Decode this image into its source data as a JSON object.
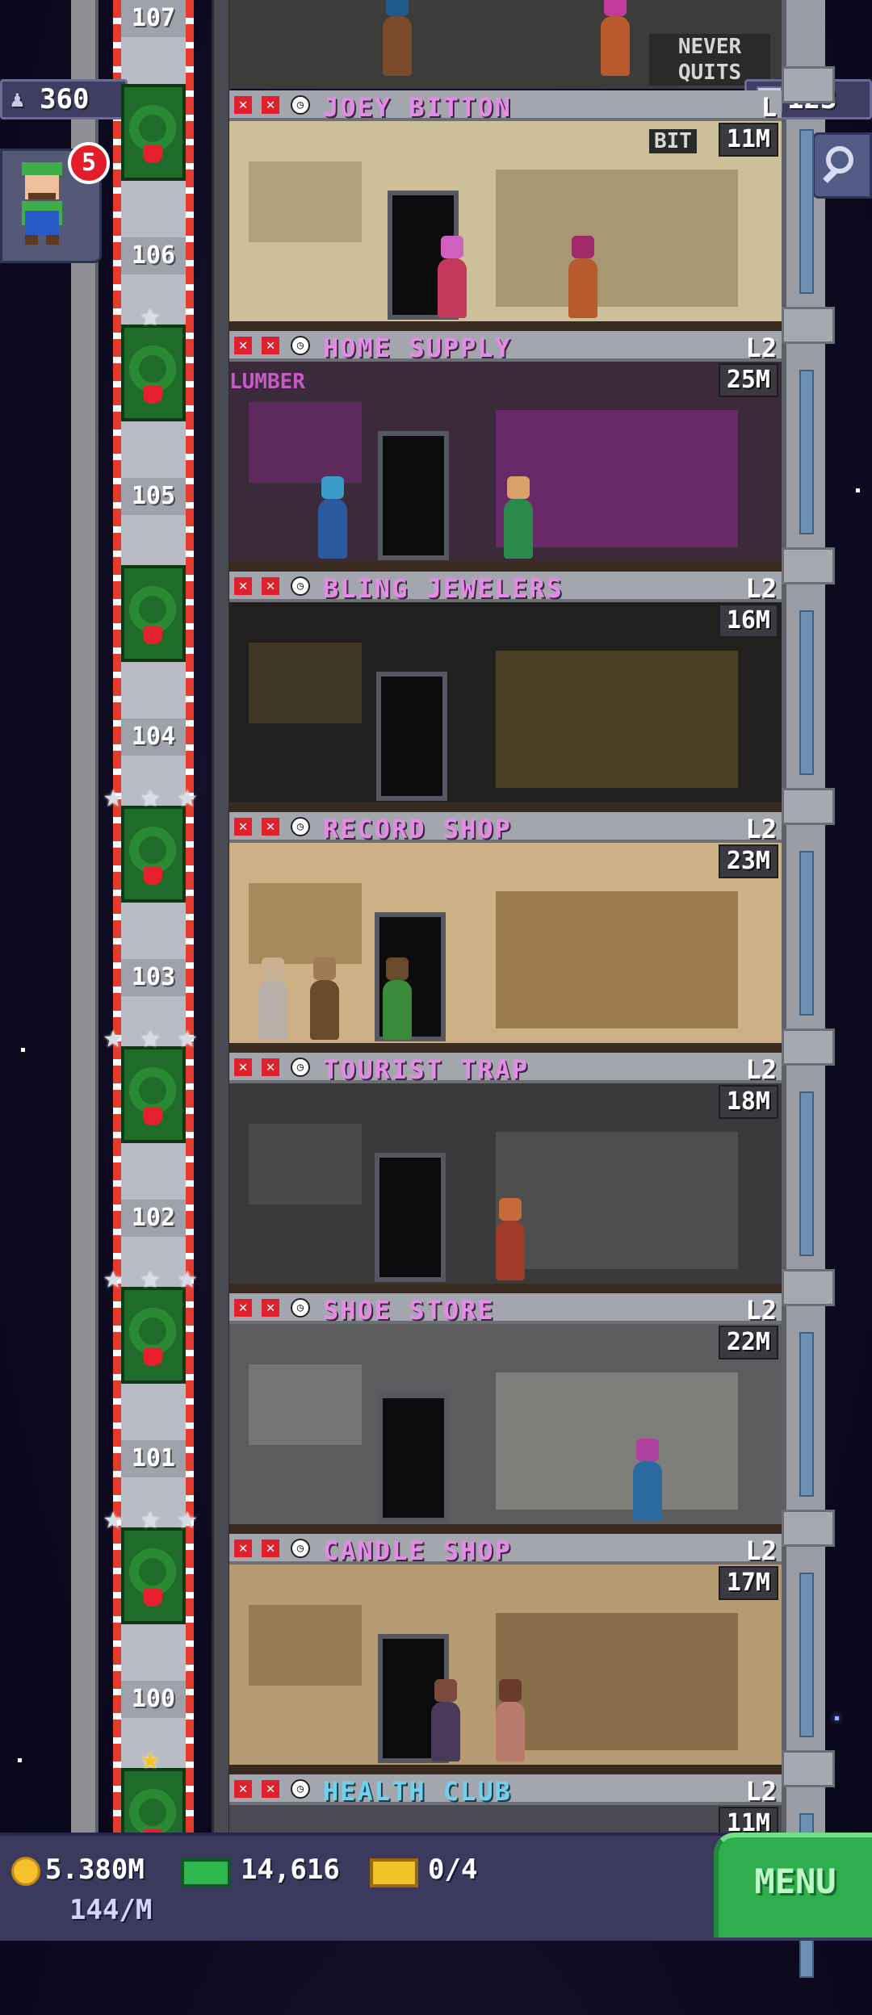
{
  "hud": {
    "population": "360",
    "floors_total": "123",
    "bitizen_notifications": "5"
  },
  "top_partial_floor": {
    "floor_number": "107",
    "sign_text": "NEVER QUITS"
  },
  "floors": [
    {
      "number": "106",
      "name": "JOEY BITTON",
      "level": "L",
      "stock": "11M",
      "sign": "BIT",
      "theme": "boutique",
      "elevator_stars": 0
    },
    {
      "number": "105",
      "name": "HOME SUPPLY",
      "level": "L2",
      "stock": "25M",
      "sign": "LUMBER",
      "theme": "hardware",
      "elevator_stars": 1
    },
    {
      "number": "104",
      "name": "BLING JEWELERS",
      "level": "L2",
      "stock": "16M",
      "sign": "",
      "theme": "jewelry",
      "elevator_stars": 0
    },
    {
      "number": "103",
      "name": "RECORD SHOP",
      "level": "L2",
      "stock": "23M",
      "sign": "",
      "theme": "records",
      "elevator_stars": 3
    },
    {
      "number": "102",
      "name": "TOURIST TRAP",
      "level": "L2",
      "stock": "18M",
      "sign": "",
      "theme": "tourist",
      "elevator_stars": 3
    },
    {
      "number": "101",
      "name": "SHOE STORE",
      "level": "L2",
      "stock": "22M",
      "sign": "",
      "theme": "shoes",
      "elevator_stars": 3
    },
    {
      "number": "100",
      "name": "CANDLE SHOP",
      "level": "L2",
      "stock": "17M",
      "sign": "",
      "theme": "candle",
      "elevator_stars": 3
    },
    {
      "number": "",
      "name": "HEALTH CLUB",
      "level": "L2",
      "stock": "11M",
      "sign": "",
      "theme": "health",
      "elevator_stars": 1
    }
  ],
  "bottom_bar": {
    "coins": "5.380M",
    "coins_rate": "144/M",
    "bux": "14,616",
    "tickets": "0/4",
    "menu_label": "MENU"
  },
  "colors": {
    "shop_name_pink": "#e68ae8",
    "shop_name_blue": "#6fd1f0",
    "menu_green": "#2eae4c",
    "hud_purple": "#3f3d63"
  },
  "icons": {
    "population": "person-icon",
    "floors": "building-icon",
    "search": "magnifier-icon",
    "coins": "coin-icon",
    "bux": "bux-icon",
    "tickets": "ticket-icon"
  }
}
